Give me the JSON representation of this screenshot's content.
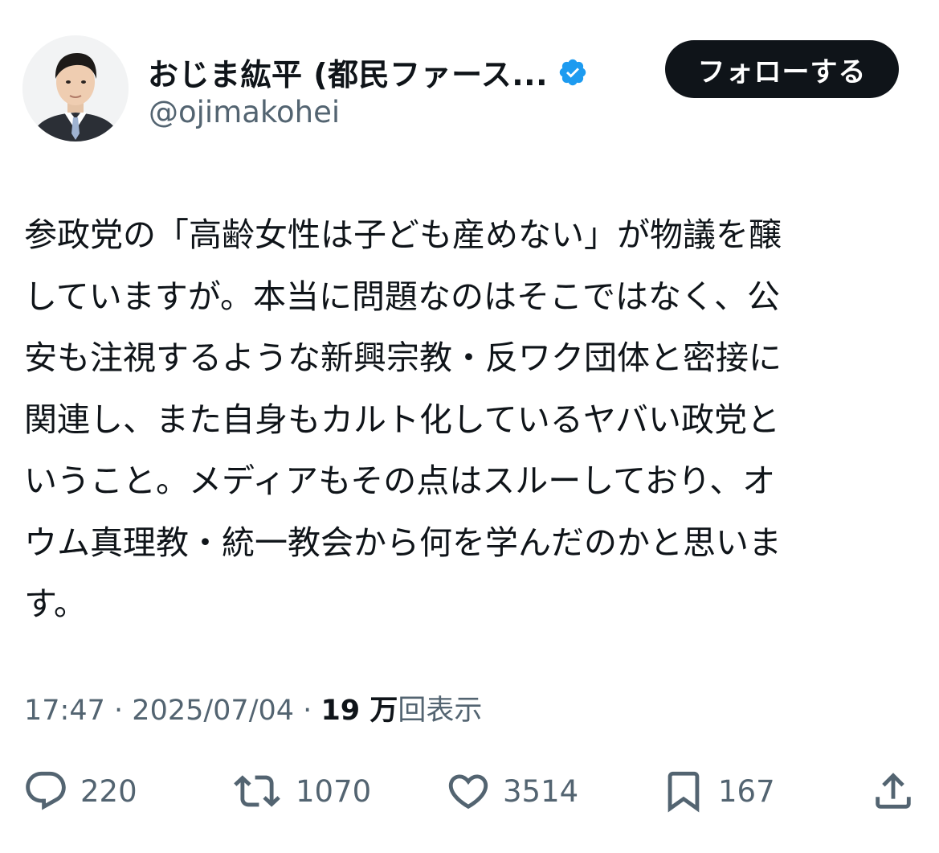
{
  "author": {
    "display_name": "おじま紘平 (都民ファース...",
    "handle": "@ojimakohei",
    "verified_icon": "verified-badge-icon",
    "avatar": "avatar-photo"
  },
  "follow_button_label": "フォローする",
  "tweet": {
    "lines": [
      "参政党の「高齢女性は子ども産めない」が物議を醸",
      "していますが。本当に問題なのはそこではなく、公",
      "安も注視するような新興宗教・反ワク団体と密接に",
      "関連し、また自身もカルト化しているヤバい政党と",
      "いうこと。メディアもその点はスルーしており、オ",
      "ウム真理教・統一教会から何を学んだのかと思いま",
      "す。"
    ]
  },
  "meta": {
    "time": "17:47",
    "separator": "·",
    "date": "2025/07/04",
    "views_count": "19 万",
    "views_label": "回表示"
  },
  "actions": {
    "replies": {
      "icon": "reply-icon",
      "count": "220"
    },
    "retweets": {
      "icon": "retweet-icon",
      "count": "1070"
    },
    "likes": {
      "icon": "heart-icon",
      "count": "3514"
    },
    "bookmarks": {
      "icon": "bookmark-icon",
      "count": "167"
    },
    "share": {
      "icon": "share-icon"
    }
  },
  "colors": {
    "text_primary": "#0f1419",
    "text_secondary": "#536471",
    "verified_blue": "#1d9bf0",
    "button_bg": "#0f1419"
  }
}
